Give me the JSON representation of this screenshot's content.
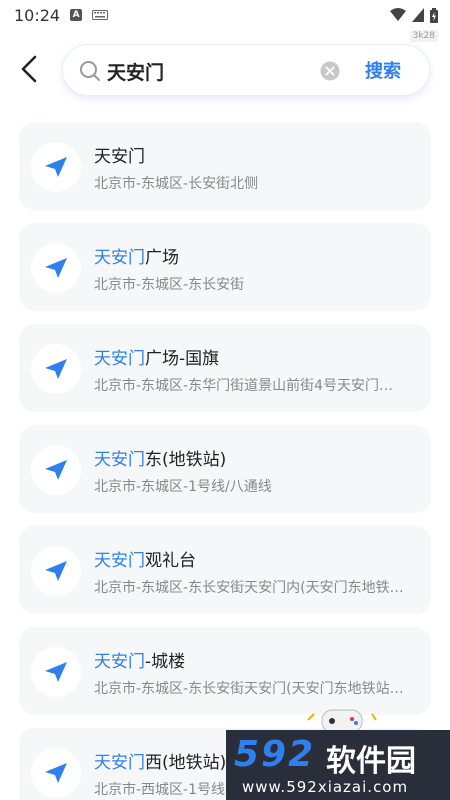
{
  "status": {
    "time": "10:24",
    "a_icon": "A",
    "speed": "3k28"
  },
  "search": {
    "value": "天安门",
    "button_label": "搜索"
  },
  "results": [
    {
      "highlight": "",
      "rest": "天安门",
      "sub": "北京市-东城区-长安街北侧"
    },
    {
      "highlight": "天安门",
      "rest": "广场",
      "sub": "北京市-东城区-东长安街"
    },
    {
      "highlight": "天安门",
      "rest": "广场-国旗",
      "sub": "北京市-东城区-东华门街道景山前街4号天安门…"
    },
    {
      "highlight": "天安门",
      "rest": "东(地铁站)",
      "sub": "北京市-东城区-1号线/八通线"
    },
    {
      "highlight": "天安门",
      "rest": "观礼台",
      "sub": "北京市-东城区-东长安街天安门内(天安门东地铁…"
    },
    {
      "highlight": "天安门",
      "rest": "-城楼",
      "sub": "北京市-东城区-东长安街天安门(天安门东地铁站…"
    },
    {
      "highlight": "天安门",
      "rest": "西(地铁站)",
      "sub": "北京市-西城区-1号线"
    }
  ],
  "watermark": {
    "logo": "592",
    "text": "软件园",
    "url": "www.592xiazai.com"
  },
  "colors": {
    "accent": "#2f80ed",
    "card_bg": "#f6f7f9"
  }
}
